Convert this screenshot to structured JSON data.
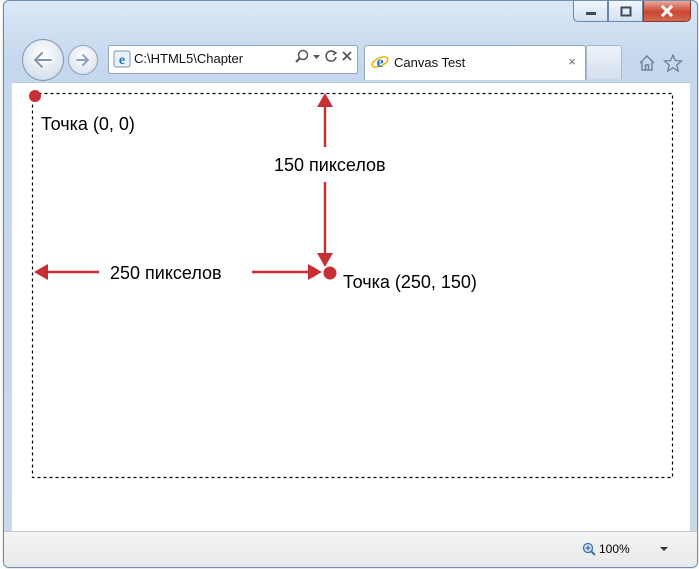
{
  "browser": {
    "address_url": "C:\\HTML5\\Chapter",
    "tab_title": "Canvas Test",
    "tab_close": "×"
  },
  "canvas": {
    "origin_label": "Точка (0, 0)",
    "vertical_label": "150 пикселов",
    "horizontal_label": "250 пикселов",
    "point_label": "Точка (250, 150)"
  },
  "status": {
    "zoom": "100%"
  },
  "colors": {
    "accent_red": "#c62f36",
    "canvas_border": "#000000"
  }
}
